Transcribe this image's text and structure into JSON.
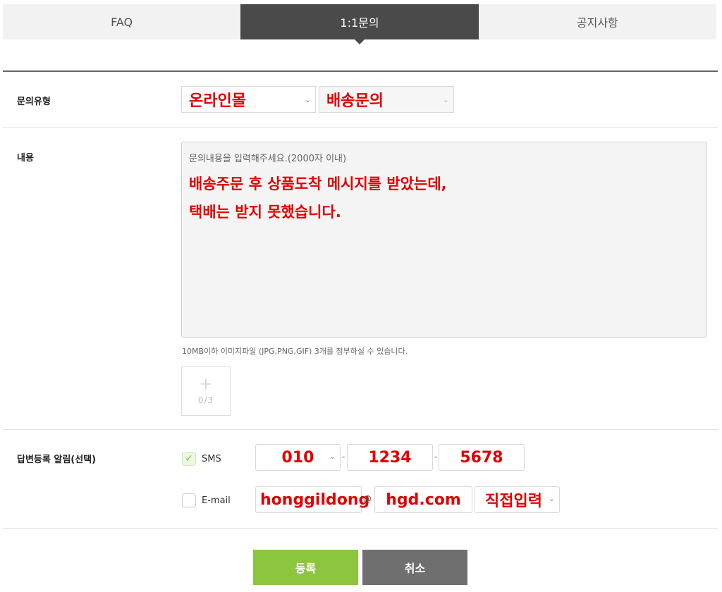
{
  "tabs": [
    {
      "label": "FAQ",
      "active": false
    },
    {
      "label": "1:1문의",
      "active": true
    },
    {
      "label": "공지사항",
      "active": false
    }
  ],
  "form": {
    "inquiry_type": {
      "label": "문의유형",
      "category_value": "온라인몰",
      "subcategory_value": "배송문의"
    },
    "content": {
      "label": "내용",
      "placeholder": "문의내용을 입력해주세요.(2000자 이내)",
      "lines": [
        "배송주문 후 상품도착 메시지를 받았는데,",
        "택배는 받지 못했습니다."
      ]
    },
    "attachment": {
      "note": "10MB이하 이미지파일 (JPG,PNG,GIF) 3개를 첨부하실 수 있습니다.",
      "plus": "+",
      "count": "0/3"
    },
    "notify": {
      "label": "답변등록 알림(선택)",
      "sms": {
        "label": "SMS",
        "checked": true,
        "phone1": "010",
        "phone2": "1234",
        "phone3": "5678",
        "dash": "-"
      },
      "email": {
        "label": "E-mail",
        "checked": false,
        "local": "honggildong",
        "at": "@",
        "domain": "hgd.com",
        "domain_select": "직접입력"
      }
    }
  },
  "buttons": {
    "submit": "등록",
    "cancel": "취소"
  },
  "colors": {
    "accent_red": "#e00000",
    "submit_green": "#8cc63f",
    "cancel_gray": "#6f6f6f",
    "active_tab": "#4a4a4a"
  },
  "icons": {
    "checkbox_checked": "check-icon",
    "dropdown": "chevron-down-icon",
    "attach": "plus-icon"
  }
}
